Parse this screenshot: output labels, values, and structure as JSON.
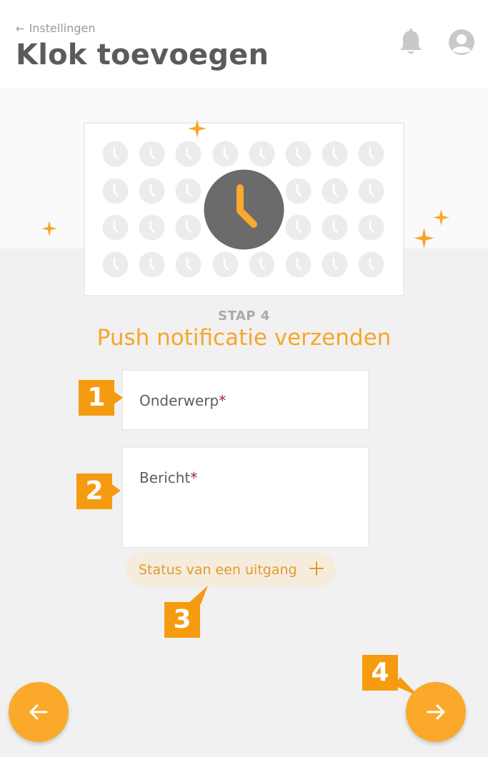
{
  "header": {
    "back_label": "Instellingen",
    "title": "Klok toevoegen",
    "icons": {
      "back": "arrow-left-icon",
      "notifications": "bell-icon",
      "account": "user-avatar-icon"
    }
  },
  "step": {
    "label": "STAP 4",
    "title": "Push notificatie verzenden"
  },
  "form": {
    "subject": {
      "label": "Onderwerp",
      "required_mark": "*"
    },
    "message": {
      "label": "Bericht",
      "required_mark": "*"
    }
  },
  "status_button": {
    "label": "Status van een uitgang",
    "icon": "plus-icon"
  },
  "markers": [
    "1",
    "2",
    "3",
    "4"
  ],
  "navigation": {
    "back_icon": "arrow-left-icon",
    "next_icon": "arrow-right-icon"
  },
  "colors": {
    "accent": "#fba92b",
    "marker": "#f59b10",
    "title_text": "#5b5b5b",
    "required": "#a52035",
    "clock_dark": "#6b6b6b",
    "clock_light": "#ececec"
  }
}
